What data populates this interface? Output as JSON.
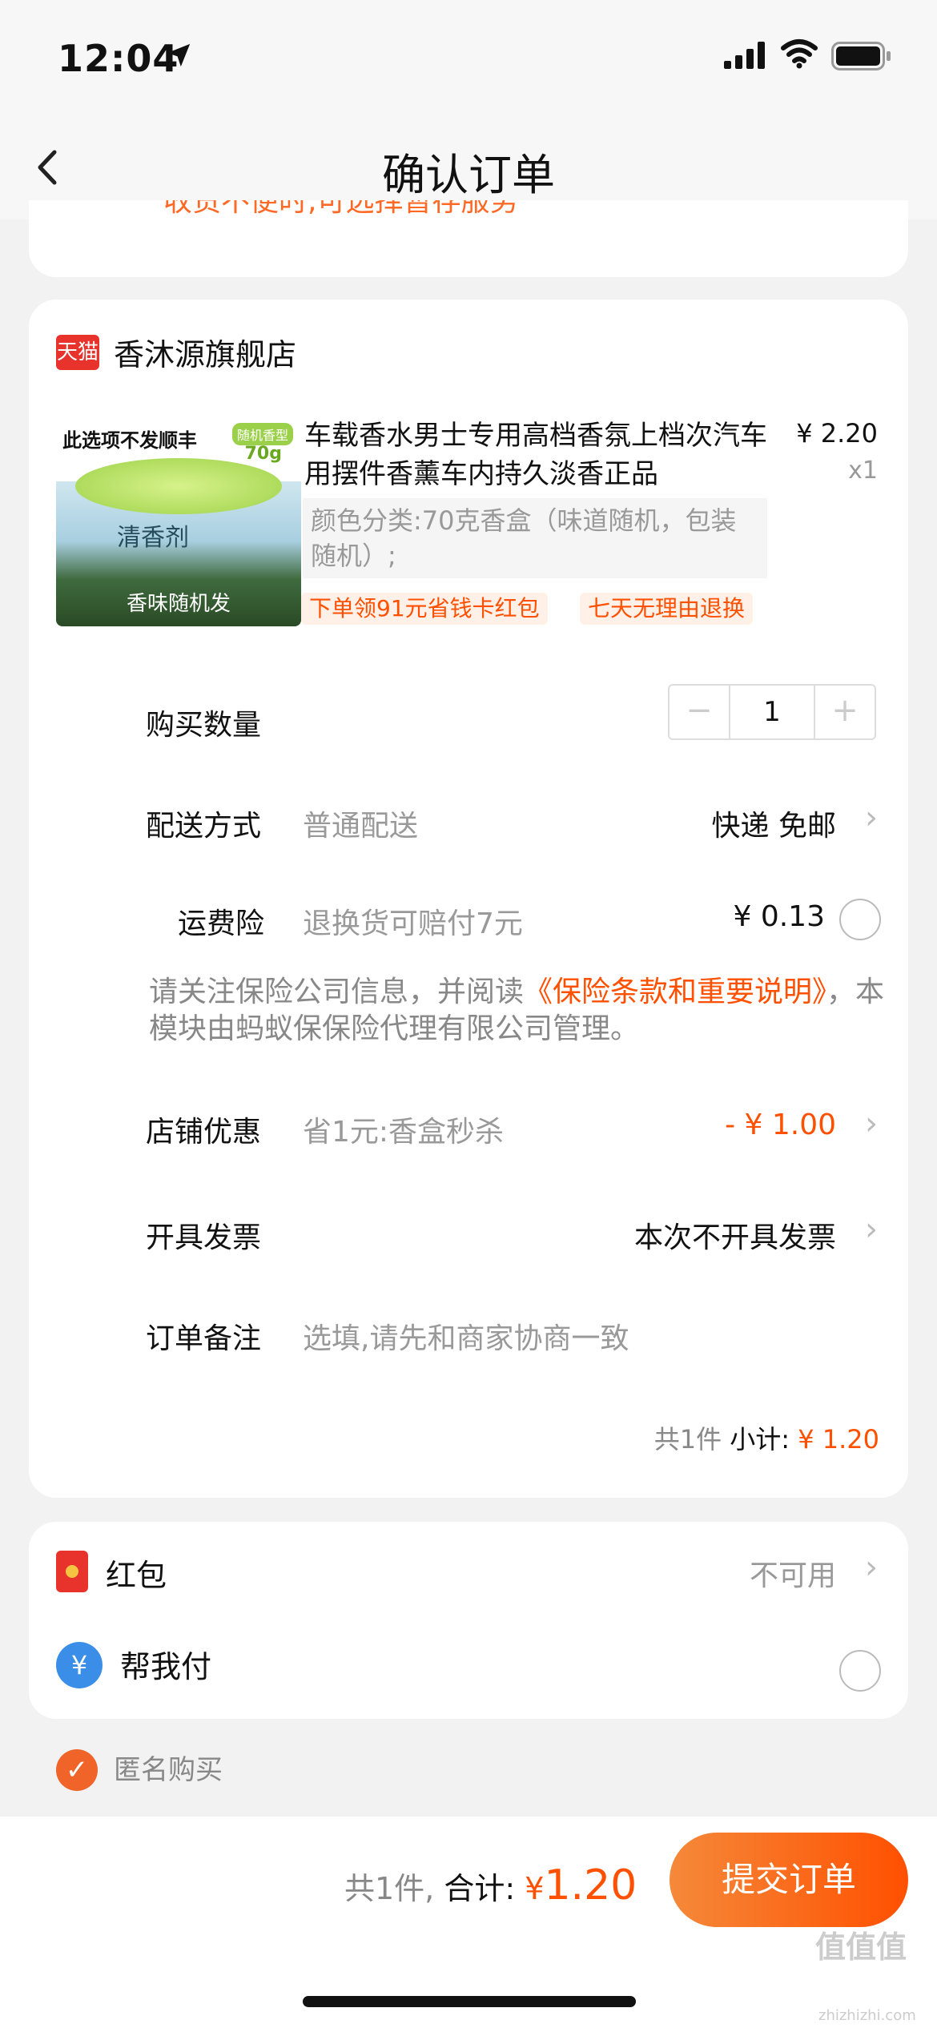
{
  "status": {
    "time": "12:04"
  },
  "nav": {
    "title": "确认订单"
  },
  "top_hint": "收货不便时,可选择暂存服务",
  "shop": {
    "badge": "天猫",
    "name": "香沐源旗舰店"
  },
  "product": {
    "img_top": "此选项不发顺丰",
    "img_badge": "随机香型",
    "img_weight": "70g",
    "img_label": "清香剂",
    "img_bottom": "香味随机发",
    "title": "车载香水男士专用高档香氛上档次汽车用摆件香薰车内持久淡香正品",
    "price": "¥ 2.20",
    "qty": "x1",
    "sku": "颜色分类:70克香盒（味道随机，包装随机）;",
    "tags": [
      "下单领91元省钱卡红包",
      "七天无理由退换"
    ]
  },
  "quantity": {
    "label": "购买数量",
    "minus": "−",
    "value": "1",
    "plus": "+"
  },
  "delivery": {
    "label": "配送方式",
    "sub": "普通配送",
    "value": "快递 免邮"
  },
  "insurance": {
    "label": "运费险",
    "sub": "退换货可赔付7元",
    "value": "¥ 0.13"
  },
  "ins_note": {
    "prefix": "请关注保险公司信息，并阅读",
    "link": "《保险条款和重要说明》",
    "suffix": "，本模块由蚂蚁保保险代理有限公司管理。"
  },
  "discount": {
    "label": "店铺优惠",
    "sub": "省1元:香盒秒杀",
    "value": "- ¥ 1.00"
  },
  "invoice": {
    "label": "开具发票",
    "value": "本次不开具发票"
  },
  "remark": {
    "label": "订单备注",
    "placeholder": "选填,请先和商家协商一致"
  },
  "subtotal": {
    "count": "共1件",
    "label": "小计:",
    "value": "¥ 1.20"
  },
  "hongbao": {
    "label": "红包",
    "value": "不可用"
  },
  "helpme": {
    "label": "帮我付"
  },
  "anonymous": {
    "label": "匿名购买"
  },
  "bottom": {
    "count": "共1件,",
    "label": "合计:",
    "currency": "¥",
    "amount": "1.20",
    "submit": "提交订单"
  },
  "watermark": {
    "text": "值值值",
    "sub": "zhizhizhi.com"
  },
  "colors": {
    "accent": "#ff5000",
    "tmall": "#e8322c"
  }
}
